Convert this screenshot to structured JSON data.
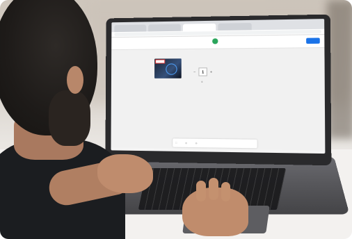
{
  "browser": {
    "tabs": [
      "",
      "",
      "",
      ""
    ],
    "url": ""
  },
  "app": {
    "title": "",
    "subtitle": "",
    "step_number": "",
    "step_label": "",
    "qty_label": "",
    "qty_value": "",
    "primary_button": ""
  },
  "content": {
    "card_title": "",
    "product_name": "",
    "product_meta": "",
    "quantity_label": "",
    "quantity_value": "1",
    "quantity_total": "0"
  },
  "bottombar": {
    "item1": "",
    "item2": "",
    "item3": ""
  },
  "colors": {
    "accent_blue": "#1a73e8",
    "step_green": "#2aa55b",
    "alert_red": "#e0322d"
  }
}
